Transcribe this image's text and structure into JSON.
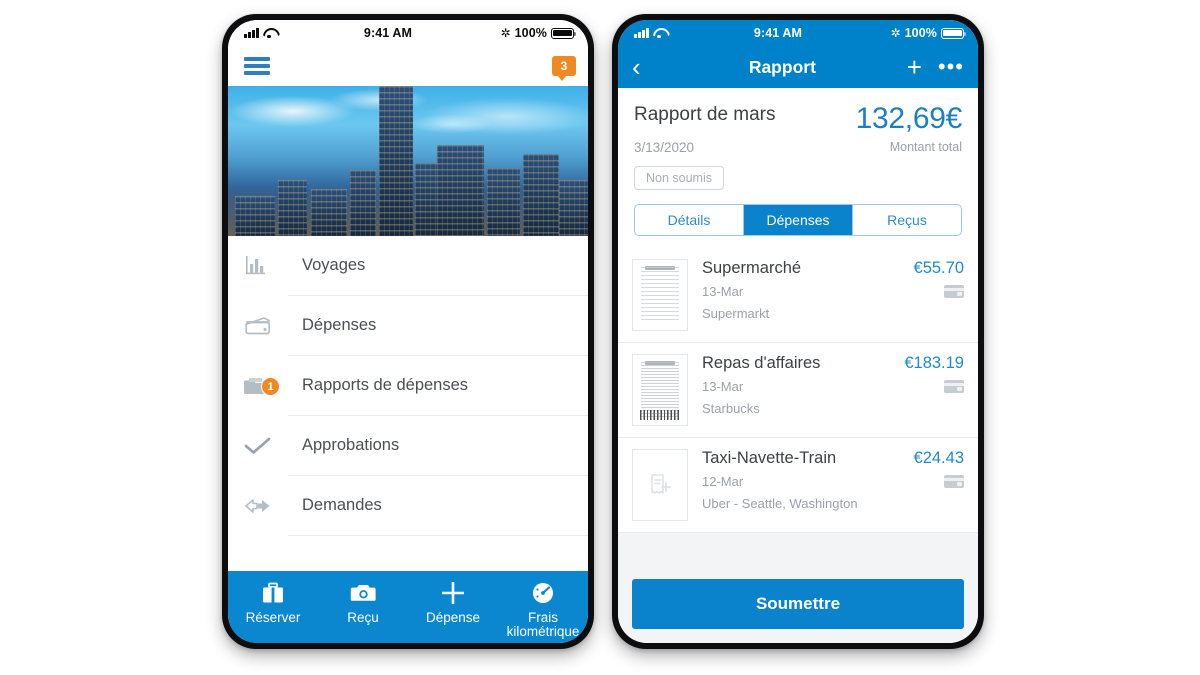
{
  "left_phone": {
    "status_bar": {
      "time": "9:41 AM",
      "battery": "100%",
      "bluetooth_icon": "bluetooth-icon",
      "wifi_icon": "wifi-icon",
      "signal_icon": "signal-icon",
      "battery_icon": "battery-icon"
    },
    "topnav": {
      "menu_icon": "hamburger-menu-icon",
      "notification_badge": "3"
    },
    "hero": {
      "alt": "city-skyline-at-dusk"
    },
    "menu": {
      "items": [
        {
          "label": "Voyages",
          "icon": "bar-chart-icon",
          "badge": ""
        },
        {
          "label": "Dépenses",
          "icon": "credit-card-icon",
          "badge": ""
        },
        {
          "label": "Rapports de dépenses",
          "icon": "folder-icon",
          "badge": "1"
        },
        {
          "label": "Approbations",
          "icon": "check-icon",
          "badge": ""
        },
        {
          "label": "Demandes",
          "icon": "arrows-exchange-icon",
          "badge": ""
        }
      ]
    },
    "tabbar": {
      "items": [
        {
          "label": "Réserver",
          "icon": "briefcase-icon"
        },
        {
          "label": "Reçu",
          "icon": "camera-icon"
        },
        {
          "label": "Dépense",
          "icon": "plus-icon"
        },
        {
          "label": "Frais kilométrique",
          "icon": "speedometer-icon"
        }
      ]
    }
  },
  "right_phone": {
    "status_bar": {
      "time": "9:41 AM",
      "battery": "100%"
    },
    "navbar": {
      "back_icon": "chevron-left-icon",
      "title": "Rapport",
      "add_icon": "plus-icon",
      "more_icon": "more-horizontal-icon"
    },
    "report": {
      "title": "Rapport de mars",
      "date": "3/13/2020",
      "amount": "132,69€",
      "amount_caption": "Montant total",
      "status": "Non soumis"
    },
    "segmented": {
      "tabs": [
        {
          "label": "Détails",
          "active": false
        },
        {
          "label": "Dépenses",
          "active": true
        },
        {
          "label": "Reçus",
          "active": false
        }
      ]
    },
    "expenses": [
      {
        "name": "Supermarché",
        "date": "13-Mar",
        "vendor": "Supermarkt",
        "amount": "€55.70",
        "thumb": "receipt-image",
        "payment_icon": "credit-card-icon"
      },
      {
        "name": "Repas d'affaires",
        "date": "13-Mar",
        "vendor": "Starbucks",
        "amount": "€183.19",
        "thumb": "receipt-image-barcode",
        "payment_icon": "credit-card-icon"
      },
      {
        "name": "Taxi-Navette-Train",
        "date": "12-Mar",
        "vendor": "Uber - Seattle, Washington",
        "amount": "€24.43",
        "thumb": "add-receipt-placeholder",
        "payment_icon": "credit-card-icon"
      }
    ],
    "footer": {
      "submit_label": "Soumettre"
    }
  },
  "colors": {
    "brand_blue": "#0082ca",
    "tabbar_blue": "#0b87d0",
    "amount_blue": "#1b7fc4",
    "badge_orange": "#ef8a22"
  }
}
